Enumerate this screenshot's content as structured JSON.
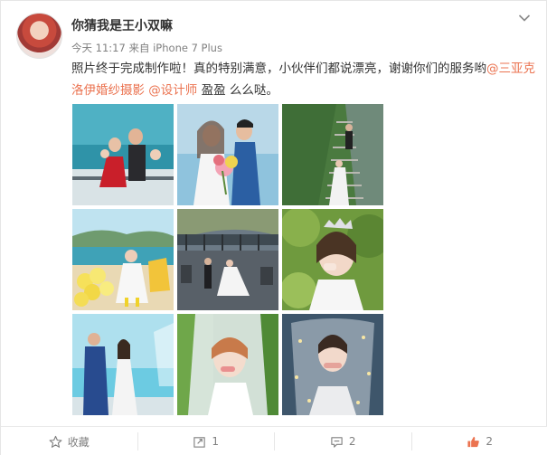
{
  "user": {
    "name": "你猜我是王小双嘛"
  },
  "meta": {
    "time": "今天 11:17",
    "from": "来自",
    "device": "iPhone 7 Plus"
  },
  "post": {
    "text_before": "照片终于完成制作啦！真的特别满意，小伙伴们都说漂亮，谢谢你们的服务哟",
    "mention_studio": "@三亚克洛伊婚纱摄影",
    "space": " ",
    "mention_designer": "@设计师",
    "text_after": " 盈盈 么么哒。"
  },
  "photos": [
    {
      "subject": "couple-on-yacht"
    },
    {
      "subject": "bride-and-groom-with-bouquet"
    },
    {
      "subject": "couple-on-stairs"
    },
    {
      "subject": "bride-on-beach-with-balloons"
    },
    {
      "subject": "couple-on-terrace"
    },
    {
      "subject": "bride-with-crown"
    },
    {
      "subject": "couple-by-sea"
    },
    {
      "subject": "bride-with-veil"
    },
    {
      "subject": "bride-under-veil"
    }
  ],
  "actions": {
    "favorite": {
      "label": "收藏",
      "icon": "star-icon"
    },
    "repost": {
      "count": "1",
      "icon": "repost-icon"
    },
    "comment": {
      "count": "2",
      "icon": "comment-icon"
    },
    "like": {
      "count": "2",
      "icon": "thumbs-up-icon",
      "color": "#eb7350"
    }
  },
  "colors": {
    "link": "#eb7350",
    "text": "#333333",
    "meta": "#808080"
  }
}
